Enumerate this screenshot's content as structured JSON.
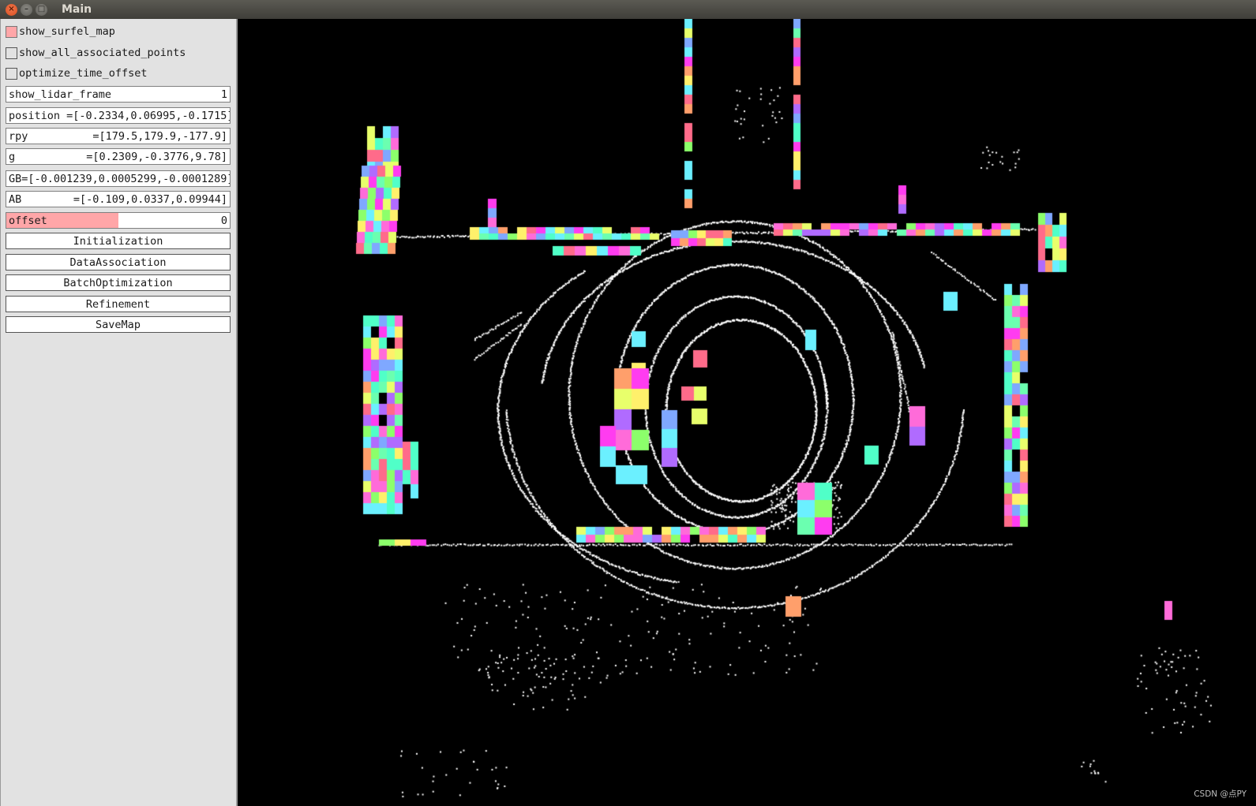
{
  "window": {
    "title": "Main",
    "controls": [
      "close",
      "minimize",
      "maximize"
    ]
  },
  "panel": {
    "checkboxes": [
      {
        "label": "show_surfel_map",
        "checked": true
      },
      {
        "label": "show_all_associated_points",
        "checked": false
      },
      {
        "label": "optimize_time_offset",
        "checked": false
      }
    ],
    "fields": [
      {
        "label": "show_lidar_frame",
        "value": "1"
      },
      {
        "label": "position ",
        "value": "=[-0.2334,0.06995,-0.1715]"
      },
      {
        "label": "rpy",
        "value": "=[179.5,179.9,-177.9]"
      },
      {
        "label": "g",
        "value": "=[0.2309,-0.3776,9.78]"
      },
      {
        "label": "GB",
        "value": "=[-0.001239,0.0005299,-0.0001289]"
      },
      {
        "label": "AB",
        "value": "=[-0.109,0.0337,0.09944]"
      }
    ],
    "slider": {
      "label": "offset",
      "value": "0",
      "fill_fraction": 0.5
    },
    "buttons": [
      "Initialization",
      "DataAssociation",
      "BatchOptimization",
      "Refinement",
      "SaveMap"
    ],
    "colors": {
      "checked": "#ffa6a8",
      "slider_fill": "#ffa6a8",
      "background": "#e2e2e2"
    }
  },
  "viewport": {
    "content": "3D lidar point cloud with colored surfel map patches",
    "background": "#000000",
    "point_color": "#ffffff",
    "surfel_palette": [
      "#ff6bd9",
      "#b06bff",
      "#6bf0ff",
      "#6bffb0",
      "#e8ff6b",
      "#ff6b8a",
      "#ff9f6b",
      "#7fa8ff",
      "#ff3cf0",
      "#8cff6b",
      "#fff06b",
      "#50ffc8"
    ],
    "watermark": "CSDN @点PY"
  }
}
